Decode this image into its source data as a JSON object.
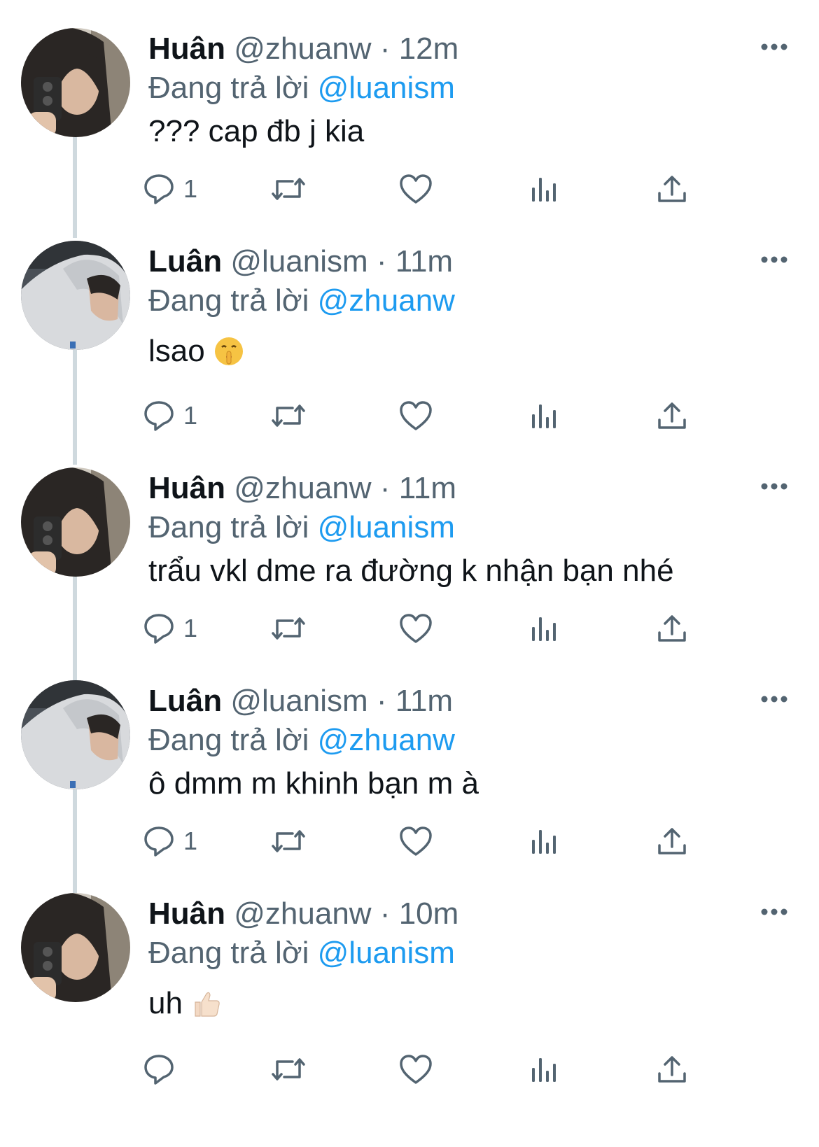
{
  "accent_color": "#1d9bf0",
  "connector_color": "#cfd9de",
  "thread": [
    {
      "author": "huan",
      "name": "Huân",
      "handle": "@zhuanw",
      "separator": "·",
      "time": "12m",
      "reply_prefix": "Đang trả lời",
      "reply_to": "@luanism",
      "text": "??? cap đb j kia",
      "emoji": "",
      "reply_count": "1",
      "icons": [
        "reply-icon",
        "retweet-icon",
        "like-icon",
        "analytics-icon",
        "share-icon",
        "more-icon"
      ]
    },
    {
      "author": "luan",
      "name": "Luân",
      "handle": "@luanism",
      "separator": "·",
      "time": "11m",
      "reply_prefix": "Đang trả lời",
      "reply_to": "@zhuanw",
      "text": "lsao",
      "emoji": "shushing-face-emoji",
      "reply_count": "1",
      "icons": [
        "reply-icon",
        "retweet-icon",
        "like-icon",
        "analytics-icon",
        "share-icon",
        "more-icon"
      ]
    },
    {
      "author": "huan",
      "name": "Huân",
      "handle": "@zhuanw",
      "separator": "·",
      "time": "11m",
      "reply_prefix": "Đang trả lời",
      "reply_to": "@luanism",
      "text": "trẩu vkl dme ra đường k nhận bạn nhé",
      "emoji": "",
      "reply_count": "1",
      "icons": [
        "reply-icon",
        "retweet-icon",
        "like-icon",
        "analytics-icon",
        "share-icon",
        "more-icon"
      ]
    },
    {
      "author": "luan",
      "name": "Luân",
      "handle": "@luanism",
      "separator": "·",
      "time": "11m",
      "reply_prefix": "Đang trả lời",
      "reply_to": "@zhuanw",
      "text": "ô dmm m khinh bạn m à",
      "emoji": "",
      "reply_count": "1",
      "icons": [
        "reply-icon",
        "retweet-icon",
        "like-icon",
        "analytics-icon",
        "share-icon",
        "more-icon"
      ]
    },
    {
      "author": "huan",
      "name": "Huân",
      "handle": "@zhuanw",
      "separator": "·",
      "time": "10m",
      "reply_prefix": "Đang trả lời",
      "reply_to": "@luanism",
      "text": "uh",
      "emoji": "thumbs-up-emoji",
      "reply_count": "",
      "icons": [
        "reply-icon",
        "retweet-icon",
        "like-icon",
        "analytics-icon",
        "share-icon",
        "more-icon"
      ]
    }
  ]
}
